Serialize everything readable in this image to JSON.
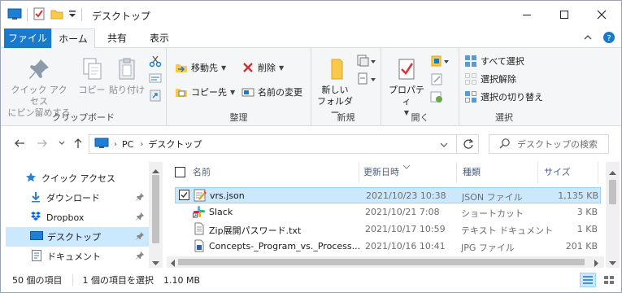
{
  "window": {
    "title": "デスクトップ"
  },
  "ribbon_tabs": {
    "file": "ファイル",
    "home": "ホーム",
    "share": "共有",
    "view": "表示"
  },
  "clipboard": {
    "pin_label_1": "クイック アクセス",
    "pin_label_2": "にピン留めする",
    "copy": "コピー",
    "paste": "貼り付け",
    "group": "クリップボード"
  },
  "organize": {
    "move_to": "移動先",
    "copy_to": "コピー先",
    "delete": "削除",
    "rename": "名前の変更",
    "group": "整理"
  },
  "new": {
    "new_folder_1": "新しい",
    "new_folder_2": "フォルダー",
    "group": "新規"
  },
  "open": {
    "properties": "プロパティ",
    "group": "開く"
  },
  "select": {
    "select_all": "すべて選択",
    "select_none": "選択解除",
    "invert": "選択の切り替え",
    "group": "選択"
  },
  "address": {
    "path": [
      "PC",
      "デスクトップ"
    ],
    "search_placeholder": "デスクトップの検索"
  },
  "nav": {
    "items": [
      {
        "label": "クイック アクセス"
      },
      {
        "label": "ダウンロード"
      },
      {
        "label": "Dropbox"
      },
      {
        "label": "デスクトップ"
      },
      {
        "label": "ドキュメント"
      }
    ]
  },
  "columns": {
    "name": "名前",
    "date": "更新日時",
    "type": "種類",
    "size": "サイズ"
  },
  "files": [
    {
      "name": "vrs.json",
      "date": "2021/10/23 10:38",
      "type": "JSON ファイル",
      "size": "1,135 KB"
    },
    {
      "name": "Slack",
      "date": "2021/10/21 7:08",
      "type": "ショートカット",
      "size": "3 KB"
    },
    {
      "name": "Zip展開パスワード.txt",
      "date": "2021/10/17 10:59",
      "type": "テキスト ドキュメント",
      "size": "1 KB"
    },
    {
      "name": "Concepts-_Program_vs._Process...",
      "date": "2021/10/16 10:41",
      "type": "JPG ファイル",
      "size": "201 KB"
    }
  ],
  "status": {
    "count": "50 個の項目",
    "selected": "1 個の項目を選択",
    "selected_size": "1.10 MB"
  },
  "colors": {
    "accent": "#1979ca",
    "selection": "#cce8ff"
  }
}
